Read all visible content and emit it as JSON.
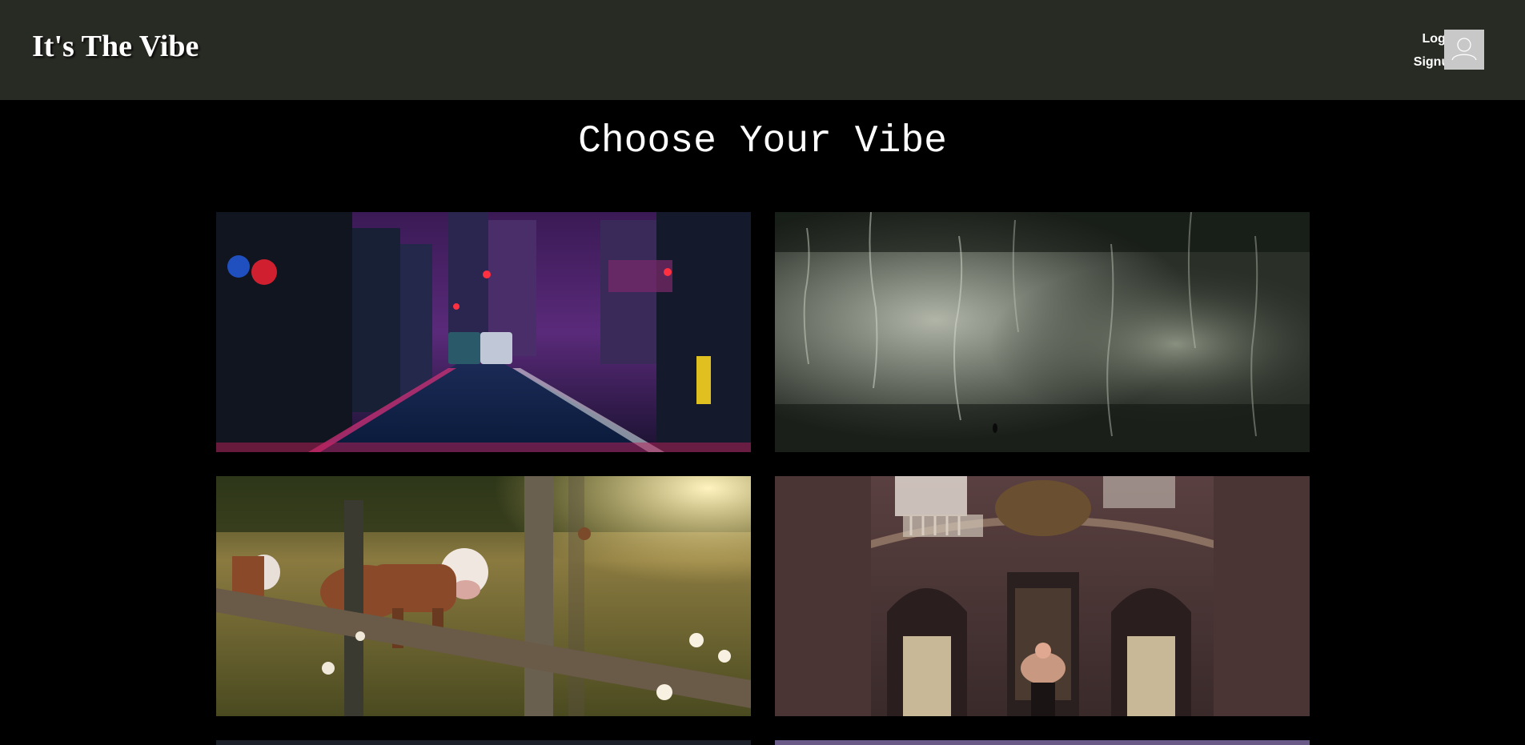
{
  "header": {
    "brand": "It's The Vibe",
    "login_label": "Login",
    "signup_label": "Signup",
    "avatar_icon": "user-avatar-icon"
  },
  "main": {
    "title": "Choose Your Vibe"
  },
  "vibes": [
    {
      "id": "neon-city-street",
      "icon": "neon-city-image"
    },
    {
      "id": "rainy-window",
      "icon": "rain-window-image"
    },
    {
      "id": "countryside-cow",
      "icon": "cow-field-image"
    },
    {
      "id": "baroque-hall",
      "icon": "palace-hall-image"
    }
  ],
  "colors": {
    "header_bg": "#282a24",
    "page_bg": "#000000",
    "text": "#ffffff",
    "avatar_bg": "#c8c8c8"
  }
}
